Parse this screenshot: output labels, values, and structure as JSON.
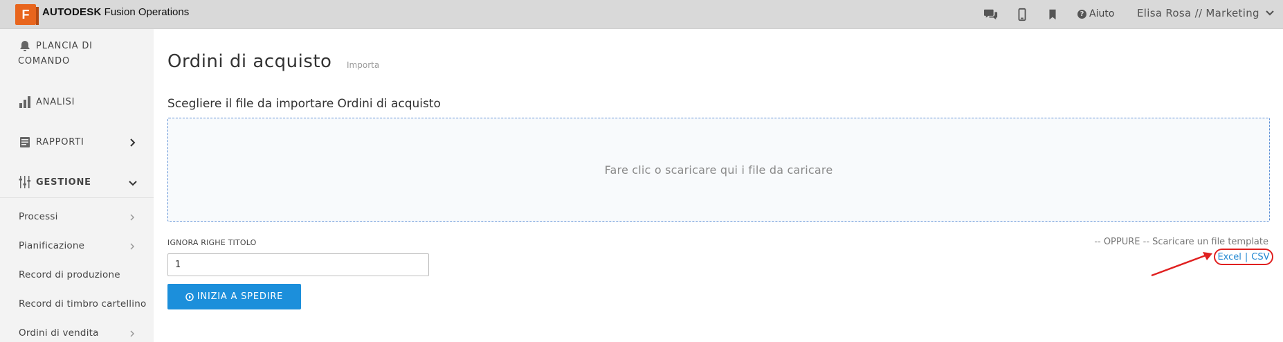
{
  "header": {
    "logo_letter": "F",
    "brand_bold": "AUTODESK",
    "brand_rest": " Fusion Operations",
    "help_label": "Aiuto",
    "user_label": "Elisa Rosa // Marketing",
    "icons": [
      "chat-icon",
      "mobile-icon",
      "bookmark-icon",
      "help-icon",
      "chevron-down-icon"
    ]
  },
  "sidebar": {
    "sections": [
      {
        "label_line1": "PLANCIA DI",
        "label_line2": "COMANDO",
        "icon": "bell-icon"
      },
      {
        "label": "ANALISI",
        "icon": "bar-chart-icon"
      },
      {
        "label": "RAPPORTI",
        "icon": "report-icon"
      },
      {
        "label": "GESTIONE",
        "icon": "sliders-icon"
      }
    ],
    "items": [
      {
        "label": "Processi",
        "has_chevron": true
      },
      {
        "label": "Pianificazione",
        "has_chevron": true
      },
      {
        "label": "Record di produzione",
        "has_chevron": false
      },
      {
        "label": "Record di timbro cartellino",
        "has_chevron": false
      },
      {
        "label": "Ordini di vendita",
        "has_chevron": true
      }
    ]
  },
  "main": {
    "title": "Ordini di acquisto",
    "subtitle": "Importa",
    "section_title": "Scegliere il file da importare Ordini di acquisto",
    "dropzone_text": "Fare clic o scaricare qui i file da caricare",
    "ignore_label": "IGNORA RIGHE TITOLO",
    "ignore_value": "1",
    "start_button": "INIZIA A SPEDIRE",
    "or_text": "-- OPPURE -- Scaricare un file template",
    "excel_link": "Excel",
    "link_sep": "|",
    "csv_link": "CSV"
  },
  "colors": {
    "accent": "#1c8fdb",
    "logo": "#e8651d",
    "highlight": "#e02020"
  }
}
